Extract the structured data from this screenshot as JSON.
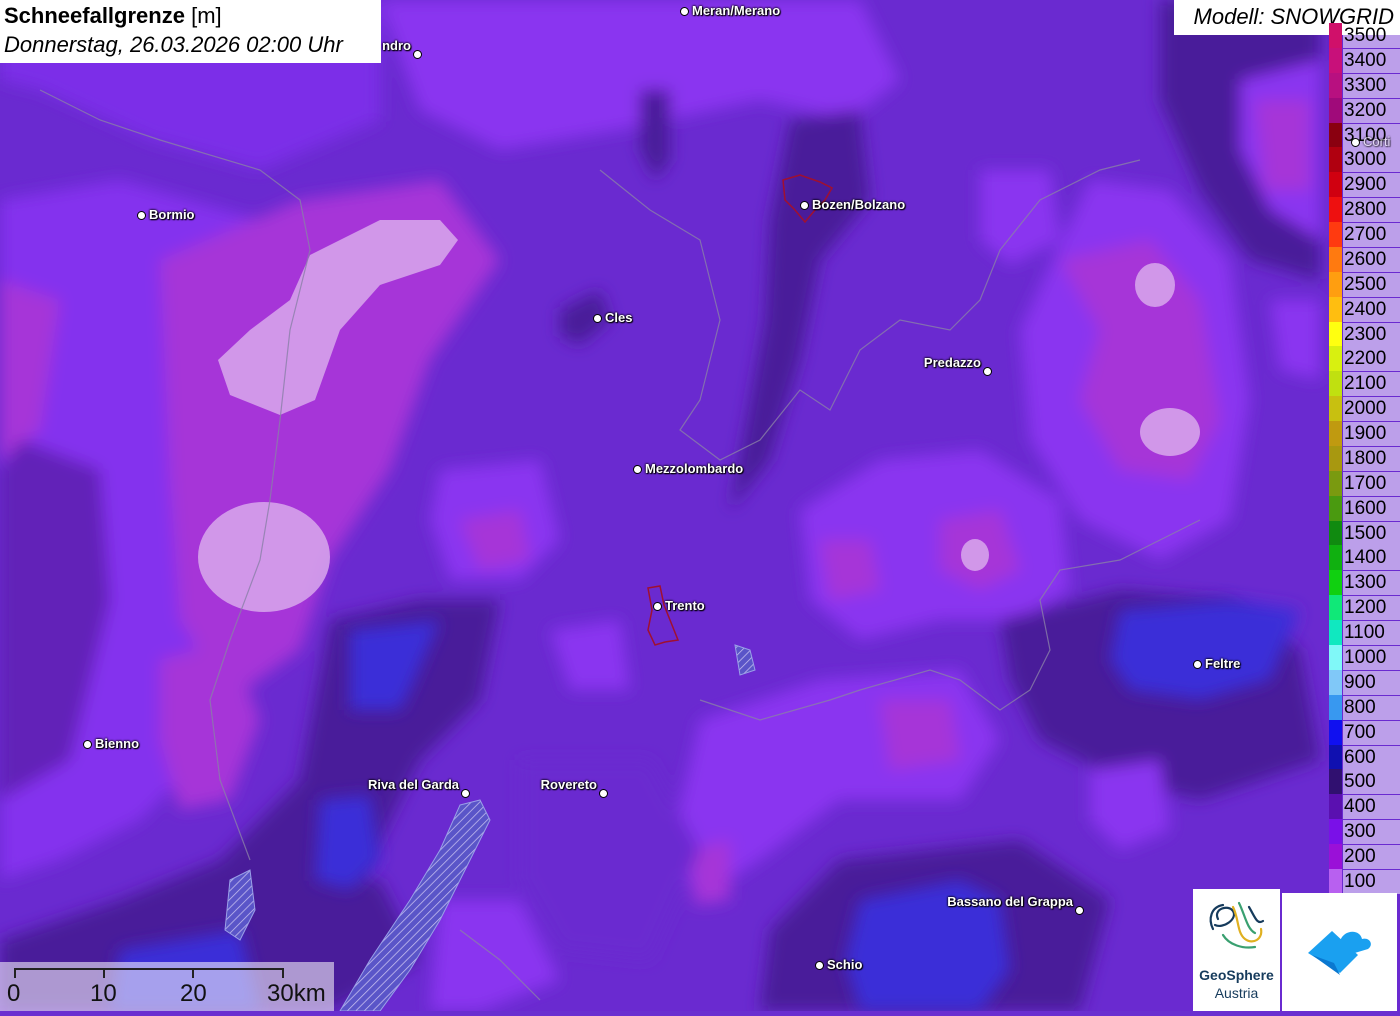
{
  "title": {
    "main": "Schneefallgrenze",
    "unit": "[m]",
    "datetime": "Donnerstag, 26.03.2026 02:00 Uhr"
  },
  "model_label": "Modell: SNOWGRID",
  "legend": [
    {
      "value": "3500",
      "color": "#d0106a"
    },
    {
      "value": "3400",
      "color": "#c8107a"
    },
    {
      "value": "3300",
      "color": "#b81080"
    },
    {
      "value": "3200",
      "color": "#a00a7a"
    },
    {
      "value": "3100",
      "color": "#8a0010"
    },
    {
      "value": "3000",
      "color": "#b00010"
    },
    {
      "value": "2900",
      "color": "#d00010"
    },
    {
      "value": "2800",
      "color": "#ee1010"
    },
    {
      "value": "2700",
      "color": "#ff3a10"
    },
    {
      "value": "2600",
      "color": "#ff7a10"
    },
    {
      "value": "2500",
      "color": "#ff9e10"
    },
    {
      "value": "2400",
      "color": "#ffbe10"
    },
    {
      "value": "2300",
      "color": "#ffff10"
    },
    {
      "value": "2200",
      "color": "#d8f010"
    },
    {
      "value": "2100",
      "color": "#c0e010"
    },
    {
      "value": "2000",
      "color": "#c8c010"
    },
    {
      "value": "1900",
      "color": "#c09a10"
    },
    {
      "value": "1800",
      "color": "#a89810"
    },
    {
      "value": "1700",
      "color": "#7a9a10"
    },
    {
      "value": "1600",
      "color": "#4a9a10"
    },
    {
      "value": "1500",
      "color": "#108a10"
    },
    {
      "value": "1400",
      "color": "#10b010"
    },
    {
      "value": "1300",
      "color": "#10d010"
    },
    {
      "value": "1200",
      "color": "#10e878"
    },
    {
      "value": "1100",
      "color": "#10e8c0"
    },
    {
      "value": "1000",
      "color": "#80f8f8"
    },
    {
      "value": "900",
      "color": "#80c8f8"
    },
    {
      "value": "800",
      "color": "#3898f0"
    },
    {
      "value": "700",
      "color": "#1010f0"
    },
    {
      "value": "600",
      "color": "#1010b0"
    },
    {
      "value": "500",
      "color": "#301070"
    },
    {
      "value": "400",
      "color": "#5a10b0"
    },
    {
      "value": "300",
      "color": "#7a10e8"
    },
    {
      "value": "200",
      "color": "#9a10d8"
    },
    {
      "value": "100",
      "color": "#b860f0"
    }
  ],
  "cities": [
    {
      "name": "Meran/Merano"
    },
    {
      "name": "ndro"
    },
    {
      "name": "Bormio"
    },
    {
      "name": "Bozen/Bolzano"
    },
    {
      "name": "Cles"
    },
    {
      "name": "Predazzo"
    },
    {
      "name": "Mezzolombardo"
    },
    {
      "name": "Trento"
    },
    {
      "name": "Feltre"
    },
    {
      "name": "Bienno"
    },
    {
      "name": "Riva del Garda"
    },
    {
      "name": "Rovereto"
    },
    {
      "name": "Bassano del Grappa"
    },
    {
      "name": "Schio"
    },
    {
      "name": "Corti"
    }
  ],
  "scale": {
    "labels": [
      "0",
      "10",
      "20",
      "30km"
    ]
  },
  "logos": {
    "geosphere_line1": "GeoSphere",
    "geosphere_line2": "Austria"
  }
}
